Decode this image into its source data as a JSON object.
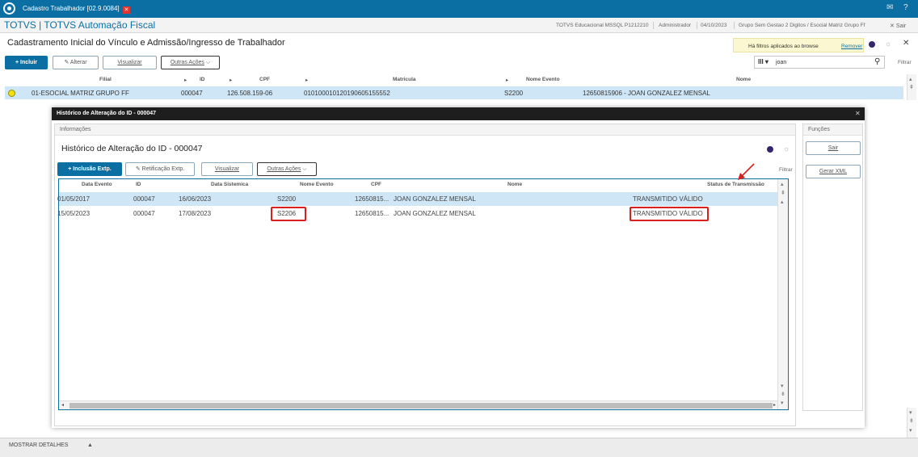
{
  "titlebar": {
    "title": "Cadastro Trabalhador [02.9.0084]",
    "close_glyph": "✕",
    "mail_icon": "mail-icon",
    "help_icon": "help-icon"
  },
  "appbar": {
    "app_title": "TOTVS | TOTVS Automação Fiscal",
    "environment": "TOTVS Educacional MSSQL P1212210",
    "user": "Administrador",
    "date": "04/10/2023",
    "group": "Grupo Sem Gestao 2 Digitos / Esocial Matriz Grupo Ff",
    "exit_label": "Sair"
  },
  "page": {
    "title": "Cadastramento Inicial do Vínculo e Admissão/Ingresso de Trabalhador",
    "filter_notice": "Há filtros aplicados ao browse",
    "filter_remove": "Remover",
    "filter_label": "Filtrar"
  },
  "toolbar": {
    "include": "+ Incluir",
    "alter": "Alterar",
    "view": "Visualizar",
    "other": "Outras Ações"
  },
  "search": {
    "value": "joan"
  },
  "main_table": {
    "columns": [
      "Filial",
      "ID",
      "CPF",
      "Matricula",
      "Nome Evento",
      "Nome"
    ],
    "row": [
      "01-ESOCIAL MATRIZ GRUPO FF",
      "000047",
      "126.508.159-06",
      "01010001012019060515555​2",
      "S2200",
      "12650815906 - JOAN GONZALEZ MENSAL"
    ]
  },
  "bottom": {
    "details": "MOSTRAR DETALHES"
  },
  "dialog": {
    "title": "Histórico de Alteração do ID - 000047",
    "info_label": "Informações",
    "heading": "Histórico de Alteração do ID - 000047",
    "functions_label": "Funções",
    "buttons": {
      "include_ext": "+ Inclusão Extp.",
      "rectify_ext": "Retificação Extp.",
      "view": "Visualizar",
      "other": "Outras Ações",
      "filter": "Filtrar",
      "exit": "Sair",
      "xml": "Gerar XML"
    },
    "columns": [
      "Data Evento",
      "ID",
      "Data Sistemica",
      "Nome Evento",
      "CPF",
      "Nome",
      "Status de Transmissão"
    ],
    "rows": [
      [
        "01/05/2017",
        "000047",
        "16/06/2023",
        "S2200",
        "12650815...",
        "JOAN GONZALEZ MENSAL",
        "TRANSMITIDO VÁLIDO"
      ],
      [
        "15/05/2023",
        "000047",
        "17/08/2023",
        "S2206",
        "12650815...",
        "JOAN GONZALEZ MENSAL",
        "TRANSMITIDO VÁLIDO"
      ]
    ]
  },
  "colors": {
    "brand": "#0c6fa3",
    "selected_row": "#cfe6f6",
    "highlight": "#d9201f",
    "status_dot": "#f2e10d"
  }
}
